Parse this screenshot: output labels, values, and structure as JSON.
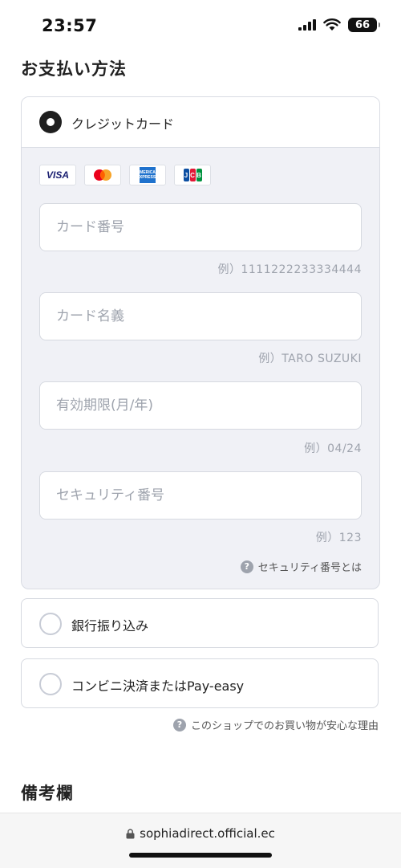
{
  "status_bar": {
    "time": "23:57",
    "battery": "66"
  },
  "payment": {
    "title": "お支払い方法",
    "credit_card": {
      "label": "クレジットカード",
      "brands": [
        "VISA",
        "Mastercard",
        "AMERICAN EXPRESS",
        "JCB"
      ],
      "fields": [
        {
          "placeholder": "カード番号",
          "example": "例）1111222233334444"
        },
        {
          "placeholder": "カード名義",
          "example": "例）TARO SUZUKI"
        },
        {
          "placeholder": "有効期限(月/年)",
          "example": "例）04/24"
        },
        {
          "placeholder": "セキュリティ番号",
          "example": "例）123"
        }
      ],
      "security_help": "セキュリティ番号とは"
    },
    "bank_transfer": {
      "label": "銀行振り込み"
    },
    "convenience": {
      "label": "コンビニ決済またはPay-easy"
    },
    "safety_help": "このショップでのお買い物が安心な理由"
  },
  "remarks": {
    "title": "備考欄"
  },
  "browser": {
    "url": "sophiadirect.official.ec"
  },
  "icons": {
    "help": "?",
    "brand_colors": {
      "visa": "#1a1f71",
      "mc_red": "#eb001b",
      "mc_yellow": "#f79e1b",
      "amex": "#1f72cd",
      "jcb_blue": "#0b4ea2",
      "jcb_red": "#e21836",
      "jcb_green": "#00923f"
    }
  }
}
